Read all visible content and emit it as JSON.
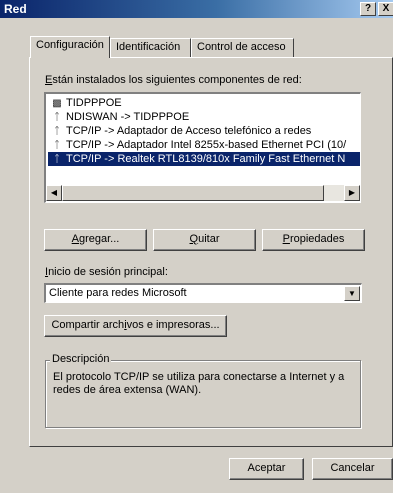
{
  "window": {
    "title": "Red",
    "help_glyph": "?",
    "close_glyph": "X"
  },
  "tabs": [
    {
      "label": "Configuración"
    },
    {
      "label": "Identificación"
    },
    {
      "label": "Control de acceso"
    }
  ],
  "components": {
    "heading_mnemonic": "E",
    "heading_rest": "stán instalados los siguientes componentes de red:",
    "items": [
      {
        "icon": "network-adapter-icon",
        "label": "TIDPPPOE"
      },
      {
        "icon": "protocol-icon",
        "label": "NDISWAN -> TIDPPPOE"
      },
      {
        "icon": "protocol-icon",
        "label": "TCP/IP -> Adaptador de Acceso telefónico a redes"
      },
      {
        "icon": "protocol-icon",
        "label": "TCP/IP -> Adaptador Intel 8255x-based Ethernet PCI (10/"
      },
      {
        "icon": "protocol-icon",
        "label": "TCP/IP -> Realtek RTL8139/810x Family Fast Ethernet N"
      }
    ],
    "selected_index": 4
  },
  "buttons": {
    "agregar_mnemonic": "A",
    "agregar_rest": "gregar...",
    "quitar_mnemonic": "Q",
    "quitar_rest": "uitar",
    "propiedades_mnemonic": "P",
    "propiedades_rest": "ropiedades",
    "compartir_pre": "Compartir arch",
    "compartir_mnemonic": "i",
    "compartir_post": "vos e impresoras...",
    "aceptar": "Aceptar",
    "cancelar": "Cancelar"
  },
  "logon": {
    "label_pre": "",
    "label_mnemonic": "I",
    "label_post": "nicio de sesión principal:",
    "selected": "Cliente para redes Microsoft"
  },
  "description": {
    "title": "Descripción",
    "text": "El protocolo TCP/IP se utiliza para conectarse a Internet y a redes de área extensa (WAN)."
  },
  "colors": {
    "titlebar": "#0a246a",
    "face": "#d4d0c8",
    "selection": "#0a246a"
  }
}
